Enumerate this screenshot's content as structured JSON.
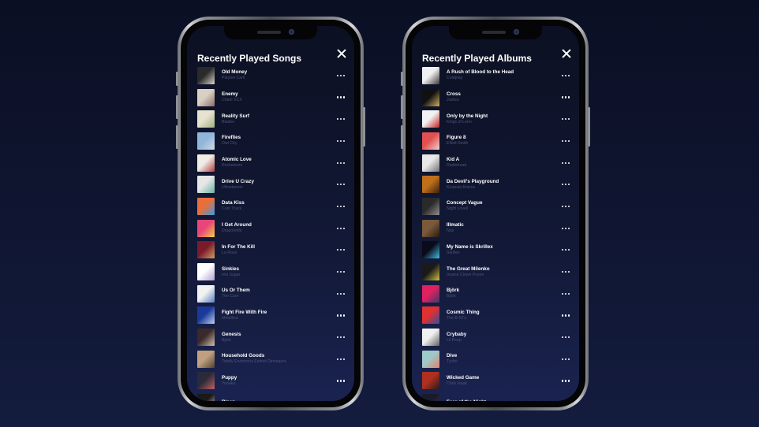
{
  "songs_panel": {
    "title": "Recently Played Songs",
    "items": [
      {
        "name": "Old Money",
        "artist": "Playboi Carti",
        "thumb_colors": [
          "#2a2a2a",
          "#d9d4c8"
        ]
      },
      {
        "name": "Enemy",
        "artist": "Charli XCX",
        "thumb_colors": [
          "#d9d0c4",
          "#8a6f66"
        ]
      },
      {
        "name": "Reality Surf",
        "artist": "Bladee",
        "thumb_colors": [
          "#e8e2d0",
          "#9fb07c"
        ]
      },
      {
        "name": "Fireflies",
        "artist": "Owl City",
        "thumb_colors": [
          "#8fb5d9",
          "#d0d9e8"
        ]
      },
      {
        "name": "Atomic Love",
        "artist": "Rocketeers",
        "thumb_colors": [
          "#f0ece6",
          "#b04040"
        ]
      },
      {
        "name": "Drive U Crazy",
        "artist": "Ultradancer",
        "thumb_colors": [
          "#e6e6e6",
          "#6ab0a8"
        ]
      },
      {
        "name": "Data Kiss",
        "artist": "Cam Track",
        "thumb_colors": [
          "#e86f3a",
          "#3a9ae8"
        ]
      },
      {
        "name": "I Get Around",
        "artist": "Dragonette",
        "thumb_colors": [
          "#e8467a",
          "#f0d040"
        ]
      },
      {
        "name": "In For The Kill",
        "artist": "La Roux",
        "thumb_colors": [
          "#7a1a2a",
          "#d0a060"
        ]
      },
      {
        "name": "Sinkies",
        "artist": "Hot Sugar",
        "thumb_colors": [
          "#ffffff",
          "#b0a0d0"
        ]
      },
      {
        "name": "Us Or Them",
        "artist": "The Cure",
        "thumb_colors": [
          "#f2f2f2",
          "#5a80c0"
        ]
      },
      {
        "name": "Fight Fire With Fire",
        "artist": "Metallica",
        "thumb_colors": [
          "#1a3a9a",
          "#c0d0f0"
        ]
      },
      {
        "name": "Genesis",
        "artist": "Björk",
        "thumb_colors": [
          "#3a2a2a",
          "#d0c0b0"
        ]
      },
      {
        "name": "Household Goods",
        "artist": "Totally Enormous Extinct Dinosaurs",
        "thumb_colors": [
          "#c0a080",
          "#504030"
        ]
      },
      {
        "name": "Puppy",
        "artist": "Yonaka",
        "thumb_colors": [
          "#2a2a3a",
          "#c06060"
        ]
      },
      {
        "name": "Bleep",
        "artist": "",
        "thumb_colors": [
          "#1a1a1a",
          "#e0d0c0"
        ]
      }
    ]
  },
  "albums_panel": {
    "title": "Recently Played Albums",
    "items": [
      {
        "name": "A Rush of Blood to the Head",
        "artist": "Coldplay",
        "thumb_colors": [
          "#f0f0f0",
          "#3a3a3a"
        ]
      },
      {
        "name": "Cross",
        "artist": "Justice",
        "thumb_colors": [
          "#111111",
          "#d0b060"
        ]
      },
      {
        "name": "Only by the Night",
        "artist": "Kings of Leon",
        "thumb_colors": [
          "#f2f2f2",
          "#c02020"
        ]
      },
      {
        "name": "Figure 8",
        "artist": "Elliott Smith",
        "thumb_colors": [
          "#e05050",
          "#f0d0d0"
        ]
      },
      {
        "name": "Kid A",
        "artist": "Radiohead",
        "thumb_colors": [
          "#e8e8e8",
          "#707070"
        ]
      },
      {
        "name": "Da Devil's Playground",
        "artist": "Koopsta Knicca",
        "thumb_colors": [
          "#c0701a",
          "#3a2010"
        ]
      },
      {
        "name": "Concept Vague",
        "artist": "Night Lovell",
        "thumb_colors": [
          "#2a2a2a",
          "#909090"
        ]
      },
      {
        "name": "Illmatic",
        "artist": "Nas",
        "thumb_colors": [
          "#7a5a3a",
          "#2a1a10"
        ]
      },
      {
        "name": "My Name is Skrillex",
        "artist": "Skrillex",
        "thumb_colors": [
          "#0a0a1a",
          "#40c0e0"
        ]
      },
      {
        "name": "The Great Milenko",
        "artist": "Insane Clown Posse",
        "thumb_colors": [
          "#1a1a1a",
          "#d0c040"
        ]
      },
      {
        "name": "Björk",
        "artist": "Björk",
        "thumb_colors": [
          "#e02060",
          "#3a3a6a"
        ]
      },
      {
        "name": "Cosmic Thing",
        "artist": "The B-52's",
        "thumb_colors": [
          "#e03030",
          "#3050a0"
        ]
      },
      {
        "name": "Crybaby",
        "artist": "Lil Peep",
        "thumb_colors": [
          "#f0f0f0",
          "#606060"
        ]
      },
      {
        "name": "Dive",
        "artist": "Tycho",
        "thumb_colors": [
          "#a0c8c8",
          "#e08070"
        ]
      },
      {
        "name": "Wicked Game",
        "artist": "Chris Isaak",
        "thumb_colors": [
          "#b03020",
          "#2a1a1a"
        ]
      },
      {
        "name": "Fear of the Night",
        "artist": "",
        "thumb_colors": [
          "#1a1a2a",
          "#3a3a50"
        ]
      }
    ]
  },
  "icons": {
    "close": "close-icon",
    "more": "more-options-icon"
  }
}
